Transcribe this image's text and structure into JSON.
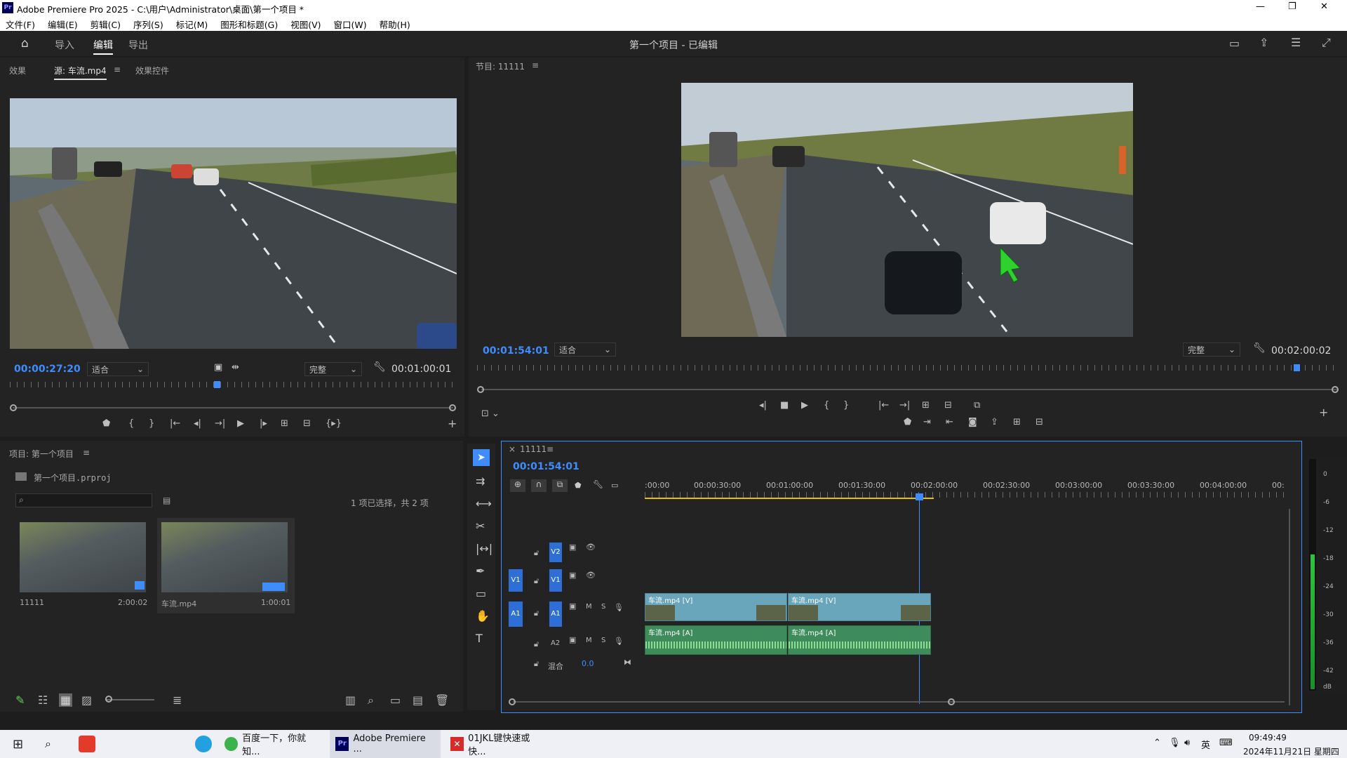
{
  "window": {
    "title": "Adobe Premiere Pro 2025 - C:\\用户\\Administrator\\桌面\\第一个项目 *",
    "controls": [
      "—",
      "❐",
      "✕"
    ]
  },
  "menu": [
    "文件(F)",
    "编辑(E)",
    "剪辑(C)",
    "序列(S)",
    "标记(M)",
    "图形和标题(G)",
    "视图(V)",
    "窗口(W)",
    "帮助(H)"
  ],
  "workspace": {
    "tabs": [
      "导入",
      "编辑",
      "导出"
    ],
    "active_tab": "编辑",
    "project_status": "第一个项目 - 已编辑"
  },
  "source_panel": {
    "tabs": [
      "效果",
      "源: 车流.mp4",
      "效果控件"
    ],
    "active_tab": "源: 车流.mp4",
    "timecode": "00:00:27:20",
    "fit": "适合",
    "quality": "完整",
    "duration": "00:01:00:01",
    "playhead_fraction": 0.46
  },
  "program_panel": {
    "title": "节目: 11111",
    "timecode": "00:01:54:01",
    "fit": "适合",
    "quality": "完整",
    "duration": "00:02:00:02",
    "playhead_fraction": 0.95
  },
  "project_panel": {
    "title": "项目: 第一个项目",
    "file": "第一个项目.prproj",
    "search_placeholder": "",
    "selection": "1 项已选择，共 2 项",
    "items": [
      {
        "name": "11111",
        "duration": "2:00:02"
      },
      {
        "name": "车流.mp4",
        "duration": "1:00:01"
      }
    ]
  },
  "timeline": {
    "sequence": "11111",
    "timecode": "00:01:54:01",
    "ruler_labels": [
      ":00:00",
      "00:00:30:00",
      "00:01:00:00",
      "00:01:30:00",
      "00:02:00:00",
      "00:02:30:00",
      "00:03:00:00",
      "00:03:30:00",
      "00:04:00:00",
      "00:"
    ],
    "tracks": {
      "v2": "V2",
      "v1": "V1",
      "a1": "A1",
      "a2": "A2",
      "mix_label": "混合",
      "mix_value": "0.0",
      "m": "M",
      "s": "S"
    },
    "clips": {
      "v1a": "车流.mp4 [V]",
      "v1b": "车流.mp4 [V]",
      "a1a": "车流.mp4 [A]",
      "a1b": "车流.mp4 [A]"
    }
  },
  "audio_meter": {
    "labels": [
      "0",
      "-6",
      "-12",
      "-18",
      "-24",
      "-30",
      "-36",
      "-42",
      "dB"
    ]
  },
  "taskbar": {
    "items": [
      "百度一下，你就知...",
      "Adobe Premiere ...",
      "01JKL键快速或快..."
    ],
    "tray_lang": "英",
    "time": "09:49:49",
    "date": "2024年11月21日 星期四"
  },
  "colors": {
    "accent": "#3f8cff",
    "clip_video": "#6aa6bb",
    "clip_audio": "#3e8c5b"
  }
}
